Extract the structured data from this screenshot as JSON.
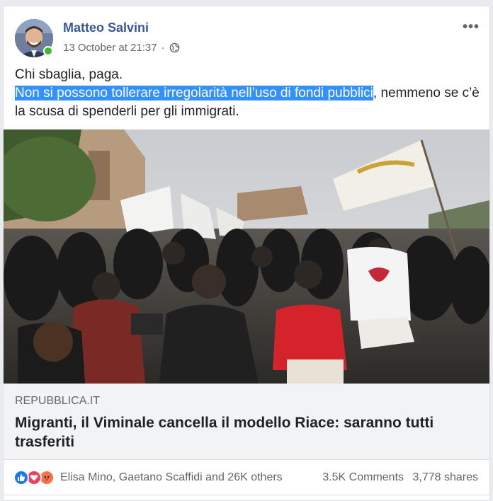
{
  "post": {
    "author": "Matteo Salvini",
    "timestamp": "13 October at 21:37",
    "separator": "·",
    "more_label": "•••",
    "text_line1": "Chi sbaglia, paga.",
    "text_highlighted": "Non si possono tollerare irregolarità nell’uso di fondi pubblici",
    "text_rest": ", nemmeno se c’è la scusa di spenderli per gli immigrati."
  },
  "link": {
    "domain": "REPUBBLICA.IT",
    "headline": "Migranti, il Viminale cancella il modello Riace: saranno tutti trasferiti"
  },
  "engagement": {
    "reaction_names": "Elisa Mino, Gaetano Scaffidi and 26K others",
    "comments": "3.5K Comments",
    "shares": "3,778 shares"
  },
  "colors": {
    "author": "#385898",
    "highlight": "#3390ff",
    "like": "#1877f2",
    "love": "#f33e58",
    "angry": "#f7714b"
  },
  "icons": {
    "reactions": [
      "like-icon",
      "love-icon",
      "angry-icon"
    ],
    "privacy": "globe-icon",
    "online": "online-status-dot"
  }
}
